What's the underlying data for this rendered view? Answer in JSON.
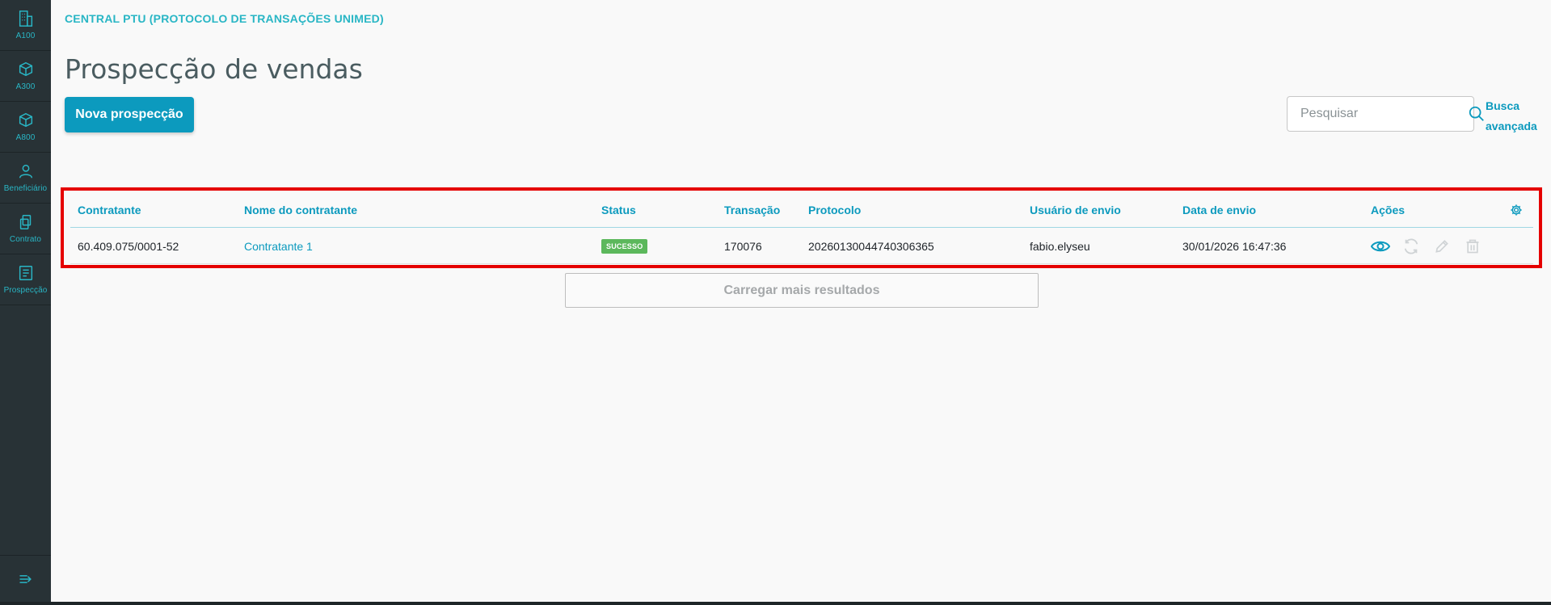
{
  "sidebar": {
    "items": [
      {
        "label": "A100",
        "icon": "building-icon"
      },
      {
        "label": "A300",
        "icon": "cube-icon"
      },
      {
        "label": "A800",
        "icon": "cube-icon"
      },
      {
        "label": "Beneficiário",
        "icon": "user-icon"
      },
      {
        "label": "Contrato",
        "icon": "documents-icon"
      },
      {
        "label": "Prospecção",
        "icon": "clipboard-icon"
      }
    ]
  },
  "header": {
    "breadcrumb": "CENTRAL PTU (PROTOCOLO DE TRANSAÇÕES UNIMED)",
    "title": "Prospecção de vendas"
  },
  "toolbar": {
    "new_button": "Nova prospecção",
    "search_placeholder": "Pesquisar",
    "advanced_search_line1": "Busca",
    "advanced_search_line2": "avançada"
  },
  "table": {
    "columns": [
      "Contratante",
      "Nome do contratante",
      "Status",
      "Transação",
      "Protocolo",
      "Usuário de envio",
      "Data de envio",
      "Ações"
    ],
    "rows": [
      {
        "contratante": "60.409.075/0001-52",
        "nome": "Contratante 1",
        "status": "SUCESSO",
        "transacao": "170076",
        "protocolo": "20260130044740306365",
        "usuario": "fabio.elyseu",
        "data": "30/01/2026 16:47:36"
      }
    ]
  },
  "load_more": "Carregar mais resultados",
  "colors": {
    "accent": "#0c9abe",
    "sidebar_bg": "#283236",
    "success": "#5cb85c",
    "highlight": "#e50000"
  }
}
